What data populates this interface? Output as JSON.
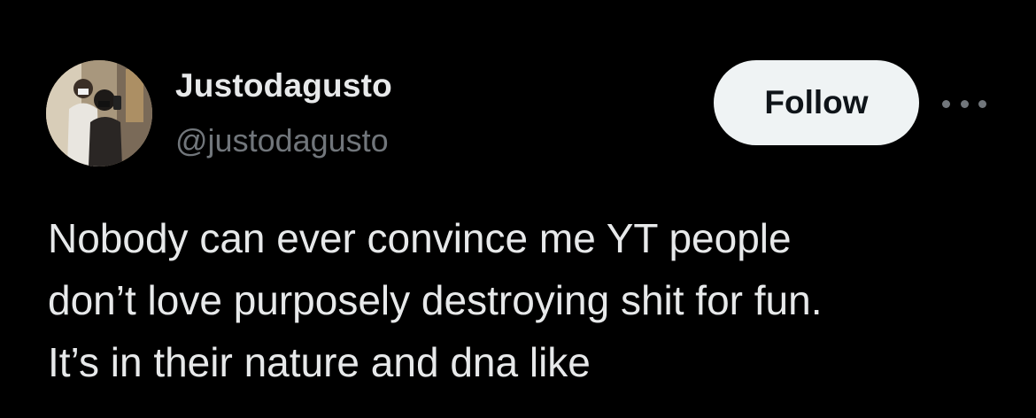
{
  "author": {
    "display_name": "Justodagusto",
    "handle": "@justodagusto",
    "avatar_icon": "profile-photo"
  },
  "actions": {
    "follow_label": "Follow",
    "more_icon": "more-horizontal-icon"
  },
  "tweet": {
    "lines": [
      "Nobody can ever convince me YT people",
      "don’t love purposely destroying shit for fun.",
      "It’s in their nature and dna like"
    ]
  },
  "colors": {
    "background": "#000000",
    "primary_text": "#e7e9ea",
    "secondary_text": "#71767b",
    "follow_button_bg": "#eff3f4",
    "follow_button_text": "#0f1419"
  }
}
